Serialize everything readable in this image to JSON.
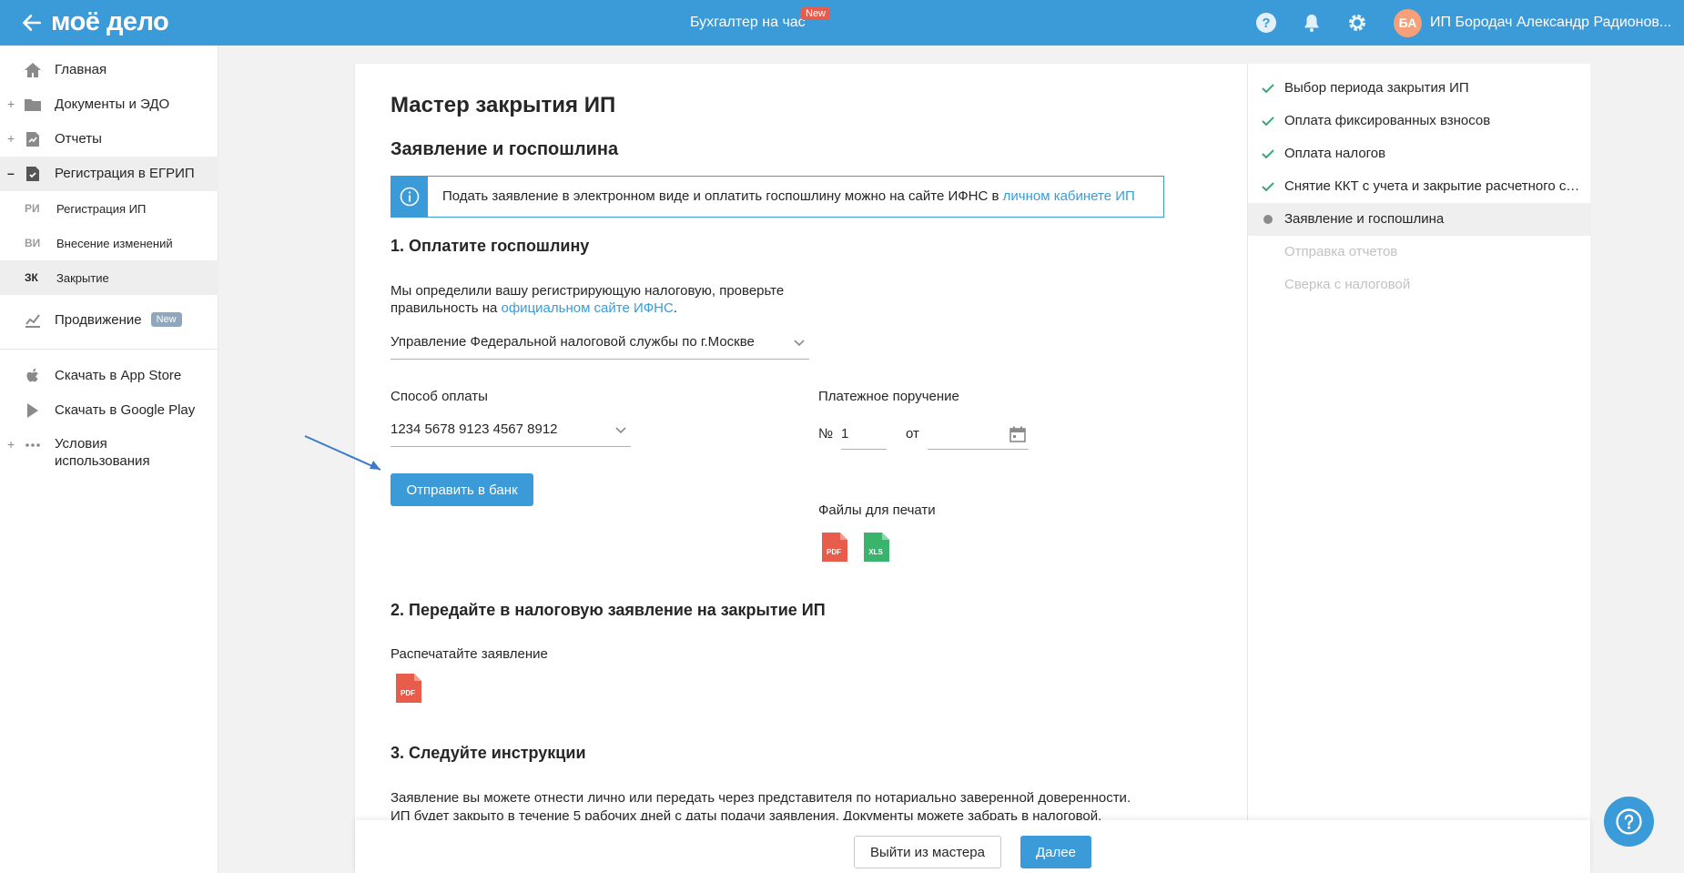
{
  "colors": {
    "brand": "#3a9bd8",
    "badge_red": "#e85c4b",
    "badge_grey": "#8fa7bd",
    "check_green": "#3aa672",
    "pdf_red": "#e85c4b",
    "xls_green": "#3ab36c"
  },
  "header": {
    "logo": "моё дело",
    "center_link": "Бухгалтер на час",
    "center_badge": "New",
    "avatar_initials": "БА",
    "user_name": "ИП Бородач Александр Радионов..."
  },
  "sidebar": {
    "items": [
      {
        "label": "Главная",
        "icon": "home-icon"
      },
      {
        "label": "Документы и ЭДО",
        "icon": "folder-icon"
      },
      {
        "label": "Отчеты",
        "icon": "report-icon"
      },
      {
        "label": "Регистрация в ЕГРИП",
        "icon": "registration-icon"
      }
    ],
    "subitems": [
      {
        "abbr": "РИ",
        "label": "Регистрация ИП"
      },
      {
        "abbr": "ВИ",
        "label": "Внесение изменений"
      },
      {
        "abbr": "ЗК",
        "label": "Закрытие"
      }
    ],
    "promo": {
      "label": "Продвижение",
      "badge": "New"
    },
    "app_store": "Скачать в App Store",
    "google_play": "Скачать в Google Play",
    "terms_line1": "Условия",
    "terms_line2": "использования"
  },
  "main": {
    "title": "Мастер закрытия ИП",
    "subtitle": "Заявление и госпошлина",
    "info_text": "Подать заявление в электронном виде и оплатить госпошлину можно на сайте ИФНС в",
    "info_link": "личном кабинете ИП",
    "step1": {
      "title": "1. Оплатите госпошлину",
      "desc_line1": "Мы определили вашу регистрирующую налоговую, проверьте",
      "desc_line2": "правильность на",
      "desc_link": "официальном сайте ИФНС",
      "desc_dot": ".",
      "tax_office": "Управление Федеральной налоговой службы по г.Москве",
      "payment_label": "Способ оплаты",
      "payment_value": "1234 5678 9123 4567 8912",
      "send_button": "Отправить в банк",
      "order_label": "Платежное поручение",
      "number_sign": "№",
      "number_value": "1",
      "from_label": "от",
      "files_label": "Файлы для печати",
      "pdf_label": "PDF",
      "xls_label": "XLS"
    },
    "step2": {
      "title": "2. Передайте в налоговую заявление на закрытие ИП",
      "print_label": "Распечатайте заявление",
      "pdf_label": "PDF"
    },
    "step3": {
      "title": "3. Следуйте инструкции",
      "line1": "Заявление вы можете отнести лично или передать через представителя по нотариально заверенной доверенности.",
      "line2": "ИП будет закрыто в течение 5 рабочих дней с даты подачи заявления. Документы можете забрать в налоговой."
    }
  },
  "footer": {
    "exit_button": "Выйти из мастера",
    "next_button": "Далее"
  },
  "steps": [
    {
      "label": "Выбор периода закрытия ИП",
      "state": "done"
    },
    {
      "label": "Оплата фиксированных взносов",
      "state": "done"
    },
    {
      "label": "Оплата налогов",
      "state": "done"
    },
    {
      "label": "Снятие ККТ с учета и закрытие расчетного счета",
      "state": "done"
    },
    {
      "label": "Заявление и госпошлина",
      "state": "current"
    },
    {
      "label": "Отправка отчетов",
      "state": "todo"
    },
    {
      "label": "Сверка с налоговой",
      "state": "todo"
    }
  ]
}
